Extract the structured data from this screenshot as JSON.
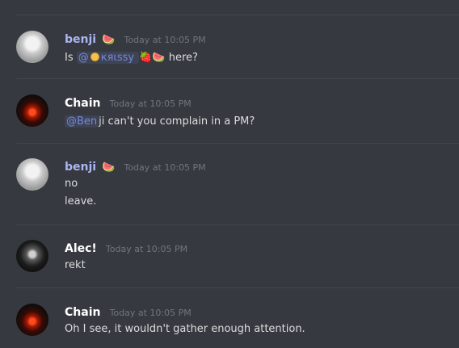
{
  "messages": [
    {
      "author": "benji",
      "author_emoji": "🍉",
      "timestamp": "Today at 10:05 PM",
      "lines": [
        "Is",
        "@",
        "кяιѕѕу",
        "🍓🍉",
        "here?"
      ]
    },
    {
      "author": "Chain",
      "timestamp": "Today at 10:05 PM",
      "lines": [
        "@Ben",
        "ji can't you complain in a PM?"
      ]
    },
    {
      "author": "benji",
      "author_emoji": "🍉",
      "timestamp": "Today at 10:05 PM",
      "lines": [
        "no",
        "leave."
      ]
    },
    {
      "author": "Alec!",
      "timestamp": "Today at 10:05 PM",
      "lines": [
        "rekt"
      ]
    },
    {
      "author": "Chain",
      "timestamp": "Today at 10:05 PM",
      "lines": [
        "Oh I see, it wouldn't gather enough attention."
      ]
    }
  ],
  "icons": [
    "avatar",
    "watermelon-emoji",
    "cookie-emoji",
    "strawberry-emoji"
  ],
  "colors": {
    "background": "#36393f",
    "username_benji": "#aab5f3",
    "mention": "#7289da"
  }
}
